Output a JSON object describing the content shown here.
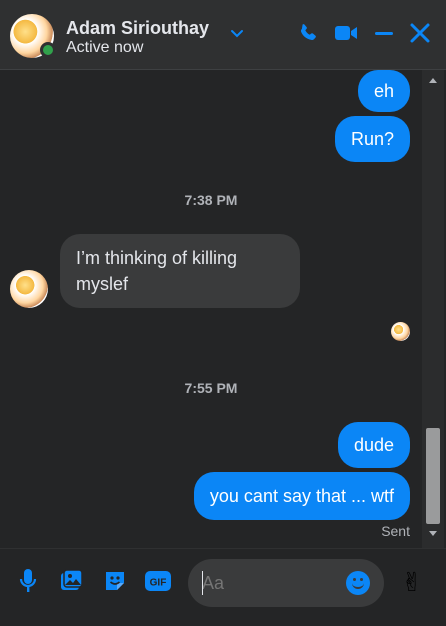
{
  "header": {
    "name": "Adam Siriouthay",
    "status": "Active now"
  },
  "messages": {
    "out_1": "eh",
    "out_2": "Run?",
    "time_1": "7:38 PM",
    "in_1": "I’m thinking of killing myslef",
    "time_2": "7:55 PM",
    "out_3": "dude",
    "out_4": "you cant say that ... wtf",
    "sent_label": "Sent"
  },
  "composer": {
    "placeholder": "Aa",
    "emoji": "✌"
  },
  "colors": {
    "accent": "#0b86f6",
    "presence": "#31a24c",
    "incoming_bubble": "#3a3b3c",
    "background": "#242526"
  }
}
